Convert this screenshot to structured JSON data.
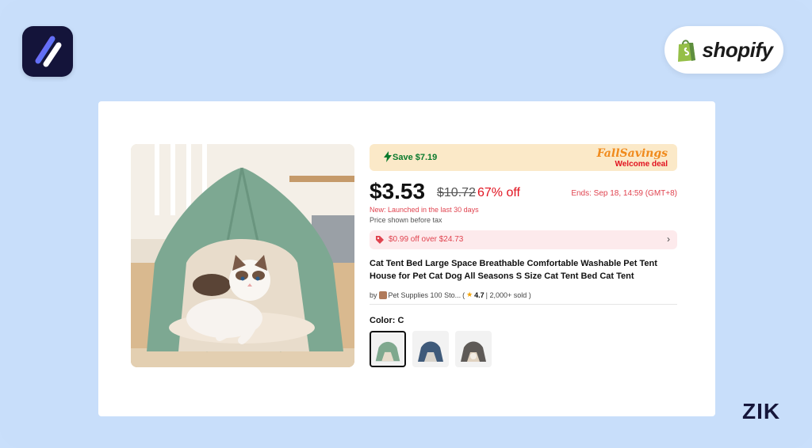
{
  "brand": {
    "app_logo": "slash-app-icon",
    "shopify_label": "shopify",
    "watermark": "ZIK"
  },
  "product": {
    "save_text": "Save $7.19",
    "fall_title": "FallSavings",
    "fall_subtitle": "Welcome deal",
    "price": "$3.53",
    "old_price": "$10.72",
    "discount": "67% off",
    "ends": "Ends: Sep 18, 14:59 (GMT+8)",
    "new_label": "New: Launched in the last 30 days",
    "tax_note": "Price shown before tax",
    "coupon_text": "$0.99 off over $24.73",
    "coupon_chevron": "›",
    "title": "Cat Tent Bed Large Space Breathable Comfortable Washable Pet Tent House for Pet Cat Dog All Seasons S Size Cat Tent Bed Cat Tent",
    "seller_prefix": "by",
    "seller_name": "Pet Supplies 100 Sto...",
    "rating_open": "(",
    "rating": "4.7",
    "sold": "| 2,000+ sold )",
    "color_label": "Color: C",
    "swatches": [
      {
        "color": "#7fa88e",
        "selected": true
      },
      {
        "color": "#3f5a7a",
        "selected": false
      },
      {
        "color": "#5e5a57",
        "selected": false
      }
    ]
  },
  "colors": {
    "accent_red": "#e1121f",
    "save_green": "#0a7a2c",
    "banner_bg": "#fbe9c8",
    "page_bg": "#c8defa"
  }
}
